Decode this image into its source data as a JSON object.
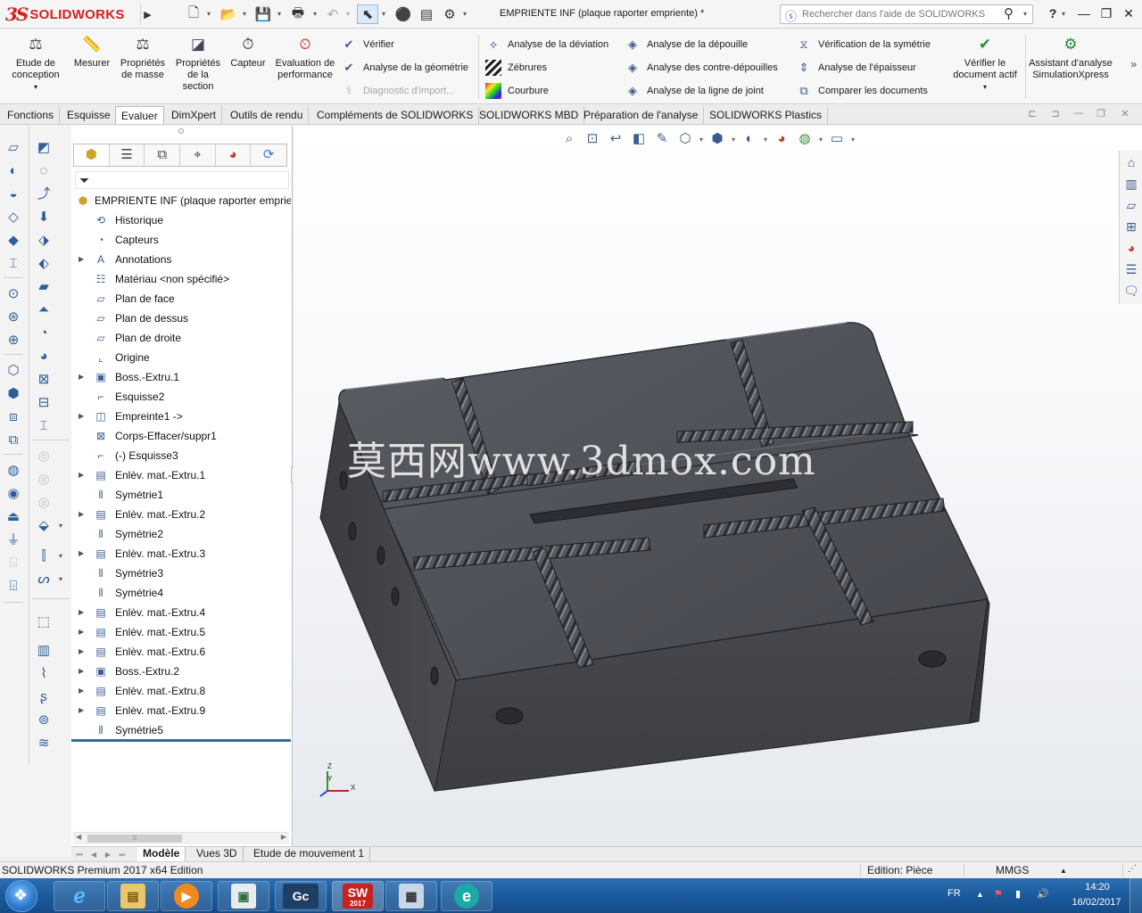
{
  "titlebar": {
    "logo_mark": "3S",
    "logo_text": "SOLIDWORKS",
    "document_title": "EMPRIENTE INF (plaque raporter  empriente) *",
    "search_placeholder": "Rechercher dans l'aide de SOLIDWORKS",
    "help_label": "?",
    "icons": [
      "new-document-icon",
      "open-icon",
      "save-icon",
      "print-icon",
      "undo-icon",
      "select-icon",
      "rebuild-icon",
      "file-properties-icon",
      "options-icon"
    ]
  },
  "command_manager": {
    "large_buttons": [
      {
        "label": "Etude de conception",
        "icon": "design-study-icon"
      },
      {
        "label": "Mesurer",
        "icon": "measure-icon"
      },
      {
        "label": "Propriétés de masse",
        "icon": "mass-properties-icon"
      },
      {
        "label": "Propriétés de la section",
        "icon": "section-properties-icon"
      },
      {
        "label": "Capteur",
        "icon": "sensor-icon"
      },
      {
        "label": "Evaluation de performance",
        "icon": "performance-icon"
      }
    ],
    "check_column": [
      {
        "label": "Vérifier",
        "enabled": true
      },
      {
        "label": "Analyse de la géométrie",
        "enabled": true
      },
      {
        "label": "Diagnostic d'import...",
        "enabled": false
      }
    ],
    "analysis_col1": [
      "Analyse de la déviation",
      "Zébrures",
      "Courbure"
    ],
    "analysis_col2": [
      "Analyse de la dépouille",
      "Analyse des contre-dépouilles",
      "Analyse de la ligne de joint"
    ],
    "analysis_col3": [
      "Vérification de la symétrie",
      "Analyse de l'épaisseur",
      "Comparer les documents"
    ],
    "verify_active": "Vérifier le document actif",
    "simulation": "Assistant d'analyse SimulationXpress",
    "more": "»"
  },
  "tabs": [
    "Fonctions",
    "Esquisse",
    "Evaluer",
    "DimXpert",
    "Outils de rendu",
    "Compléments de SOLIDWORKS",
    "SOLIDWORKS MBD",
    "Préparation de l'analyse",
    "SOLIDWORKS Plastics"
  ],
  "active_tab": "Evaluer",
  "feature_tree": {
    "root": "EMPRIENTE INF (plaque raporter  empriente)",
    "items": [
      {
        "label": "Historique",
        "expandable": false,
        "icon": "history-icon"
      },
      {
        "label": "Capteurs",
        "expandable": false,
        "icon": "sensors-icon"
      },
      {
        "label": "Annotations",
        "expandable": true,
        "icon": "annotations-icon"
      },
      {
        "label": "Matériau <non spécifié>",
        "expandable": false,
        "icon": "material-icon"
      },
      {
        "label": "Plan de face",
        "expandable": false,
        "icon": "plane-icon"
      },
      {
        "label": "Plan de dessus",
        "expandable": false,
        "icon": "plane-icon"
      },
      {
        "label": "Plan de droite",
        "expandable": false,
        "icon": "plane-icon"
      },
      {
        "label": "Origine",
        "expandable": false,
        "icon": "origin-icon"
      },
      {
        "label": "Boss.-Extru.1",
        "expandable": true,
        "icon": "extrude-icon"
      },
      {
        "label": "Esquisse2",
        "expandable": false,
        "icon": "sketch-icon"
      },
      {
        "label": "Empreinte1 ->",
        "expandable": true,
        "icon": "cavity-icon"
      },
      {
        "label": "Corps-Effacer/suppr1",
        "expandable": false,
        "icon": "delete-body-icon"
      },
      {
        "label": "(-) Esquisse3",
        "expandable": false,
        "icon": "sketch-icon"
      },
      {
        "label": "Enlèv. mat.-Extru.1",
        "expandable": true,
        "icon": "cut-extrude-icon"
      },
      {
        "label": "Symétrie1",
        "expandable": false,
        "icon": "mirror-icon"
      },
      {
        "label": "Enlèv. mat.-Extru.2",
        "expandable": true,
        "icon": "cut-extrude-icon"
      },
      {
        "label": "Symétrie2",
        "expandable": false,
        "icon": "mirror-icon"
      },
      {
        "label": "Enlèv. mat.-Extru.3",
        "expandable": true,
        "icon": "cut-extrude-icon"
      },
      {
        "label": "Symétrie3",
        "expandable": false,
        "icon": "mirror-icon"
      },
      {
        "label": "Symétrie4",
        "expandable": false,
        "icon": "mirror-icon"
      },
      {
        "label": "Enlèv. mat.-Extru.4",
        "expandable": true,
        "icon": "cut-extrude-icon"
      },
      {
        "label": "Enlèv. mat.-Extru.5",
        "expandable": true,
        "icon": "cut-extrude-icon"
      },
      {
        "label": "Enlèv. mat.-Extru.6",
        "expandable": true,
        "icon": "cut-extrude-icon"
      },
      {
        "label": "Boss.-Extru.2",
        "expandable": true,
        "icon": "extrude-icon"
      },
      {
        "label": "Enlèv. mat.-Extru.8",
        "expandable": true,
        "icon": "cut-extrude-icon"
      },
      {
        "label": "Enlèv. mat.-Extru.9",
        "expandable": true,
        "icon": "cut-extrude-icon"
      },
      {
        "label": "Symétrie5",
        "expandable": false,
        "icon": "mirror-icon"
      }
    ]
  },
  "viewport": {
    "watermark": "莫西网www.3dmox.com",
    "triad": {
      "x": "X",
      "y": "Y",
      "z": "Z"
    },
    "model_color": "#4a4c52"
  },
  "bottom_tabs": [
    "Modèle",
    "Vues 3D",
    "Etude de mouvement 1"
  ],
  "status": {
    "product": "SOLIDWORKS Premium 2017 x64 Edition",
    "edition": "Edition: Pièce",
    "units": "MMGS",
    "units_arrow": "▲"
  },
  "taskbar": {
    "apps": [
      "ie-icon",
      "explorer-icon",
      "media-player-icon",
      "window-icon",
      "gc-icon",
      "solidworks-2017-icon",
      "calculator-icon",
      "eset-icon"
    ],
    "gc_label": "Gc",
    "sw_label": "SW",
    "sw_year": "2017",
    "eset_label": "e",
    "language": "FR",
    "time": "14:20",
    "date": "16/02/2017"
  }
}
